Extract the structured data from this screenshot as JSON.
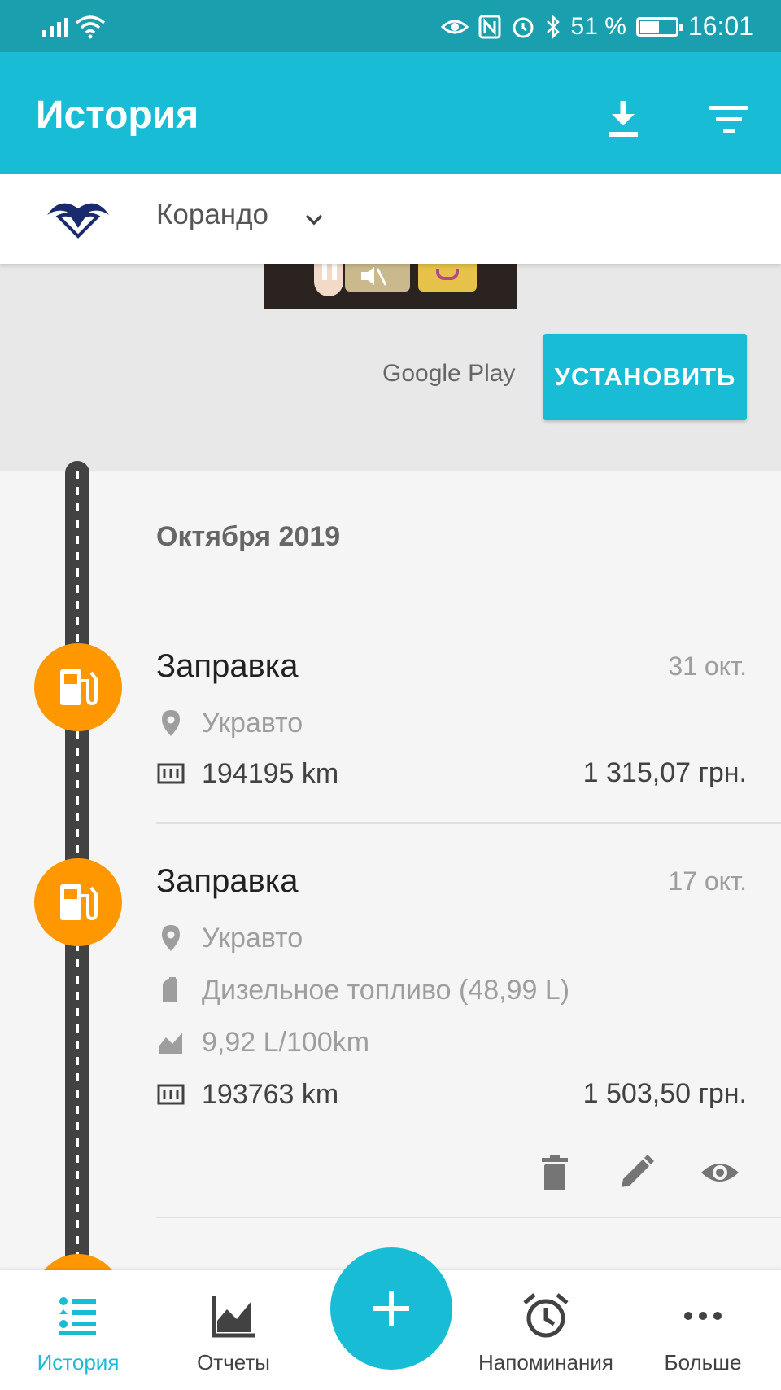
{
  "status_bar": {
    "battery": "51 %",
    "battery_level": 0.51,
    "time": "16:01"
  },
  "app_bar": {
    "title": "История",
    "download_icon": "download-icon",
    "filter_icon": "filter-icon"
  },
  "vehicle": {
    "name": "Корандо",
    "logo_icon": "car-brand-logo"
  },
  "ad": {
    "store": "Google Play",
    "install_label": "УСТАНОВИТЬ"
  },
  "history": {
    "month": "Октября 2019",
    "entries": [
      {
        "type": "Заправка",
        "date": "31 окт.",
        "station": "Укравто",
        "odometer": "194195 km",
        "cost": "1 315,07 грн."
      },
      {
        "type": "Заправка",
        "date": "17 окт.",
        "station": "Укравто",
        "fuel": "Дизельное топливо (48,99 L)",
        "consumption": "9,92 L/100km",
        "odometer": "193763 km",
        "cost": "1 503,50 грн."
      }
    ]
  },
  "bottom_nav": {
    "items": [
      {
        "label": "История",
        "icon": "history-list-icon",
        "active": true
      },
      {
        "label": "Отчеты",
        "icon": "reports-chart-icon",
        "active": false
      },
      {
        "label": "Напоминания",
        "icon": "alarm-clock-icon",
        "active": false
      },
      {
        "label": "Больше",
        "icon": "more-dots-icon",
        "active": false
      }
    ],
    "fab_icon": "plus-icon"
  },
  "colors": {
    "primary": "#18bcd4",
    "status_bar": "#1a9fae",
    "accent": "#ff9800"
  }
}
